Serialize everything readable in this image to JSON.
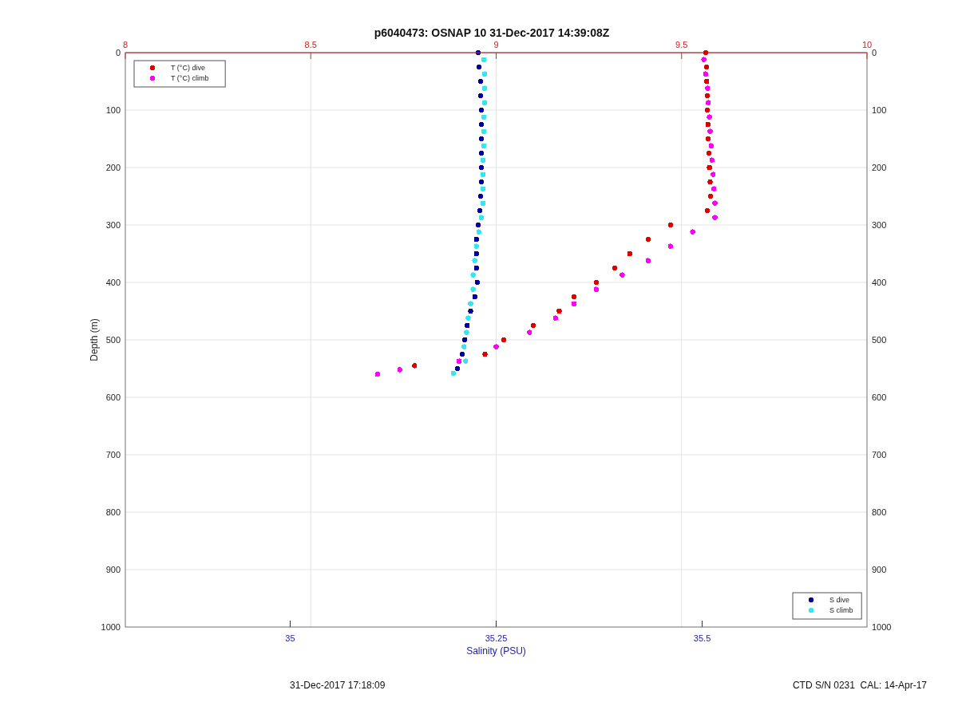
{
  "figure": {
    "title": "p6040473: OSNAP 10 31-Dec-2017 14:39:08Z",
    "salinity_axes": {
      "chart_data": {
        "type": "scatter",
        "xlabel": "Salinity (PSU)",
        "ylabel": "Depth (m)",
        "legend": "bottom-right",
        "xlim": [
          34.8,
          35.7
        ],
        "ylim": [
          1000,
          0
        ],
        "xticks": [
          35,
          35.25,
          35.5
        ],
        "yticks": [
          0,
          100,
          200,
          300,
          400,
          500,
          600,
          700,
          800,
          900,
          1000
        ],
        "series": [
          {
            "name": "S dive",
            "color": "#0000a0",
            "x": [
              35.228,
              35.229,
              35.231,
              35.231,
              35.232,
              35.232,
              35.232,
              35.232,
              35.232,
              35.232,
              35.231,
              35.23,
              35.228,
              35.226,
              35.226,
              35.226,
              35.227,
              35.224,
              35.219,
              35.215,
              35.212,
              35.209,
              35.203
            ],
            "values": [
              0,
              25,
              50,
              75,
              100,
              125,
              150,
              175,
              200,
              225,
              250,
              275,
              300,
              325,
              350,
              375,
              400,
              425,
              450,
              475,
              500,
              525,
              550
            ]
          },
          {
            "name": "S climb",
            "color": "#33e6f0",
            "x": [
              35.235,
              35.236,
              35.236,
              35.236,
              35.235,
              35.235,
              35.235,
              35.234,
              35.234,
              35.234,
              35.234,
              35.232,
              35.229,
              35.226,
              35.224,
              35.222,
              35.222,
              35.219,
              35.216,
              35.214,
              35.211,
              35.213,
              35.198
            ],
            "values": [
              12,
              37,
              62,
              87,
              112,
              137,
              162,
              187,
              212,
              237,
              262,
              287,
              312,
              337,
              362,
              387,
              412,
              437,
              462,
              487,
              512,
              537,
              558
            ]
          }
        ]
      }
    },
    "temperature_axes": {
      "chart_data": {
        "type": "scatter",
        "legend": "top-left",
        "xlim": [
          8,
          10
        ],
        "ylim": [
          1000,
          0
        ],
        "xticks": [
          8,
          8.5,
          9,
          9.5,
          10
        ],
        "yticks": [
          0,
          100,
          200,
          300,
          400,
          500,
          600,
          700,
          800,
          900,
          1000
        ],
        "series": [
          {
            "name": "T (°C) dive",
            "color": "#e00000",
            "x": [
              9.565,
              9.567,
              9.568,
              9.569,
              9.57,
              9.571,
              9.572,
              9.574,
              9.575,
              9.577,
              9.578,
              9.57,
              9.47,
              9.41,
              9.36,
              9.32,
              9.27,
              9.21,
              9.17,
              9.1,
              9.02,
              8.97,
              8.78
            ],
            "values": [
              0,
              25,
              50,
              75,
              100,
              125,
              150,
              175,
              200,
              225,
              250,
              275,
              300,
              325,
              350,
              375,
              400,
              425,
              450,
              475,
              500,
              525,
              545
            ]
          },
          {
            "name": "T (°C) climb",
            "color": "#ff00ff",
            "x": [
              9.56,
              9.565,
              9.57,
              9.572,
              9.575,
              9.577,
              9.58,
              9.582,
              9.585,
              9.587,
              9.59,
              9.59,
              9.53,
              9.47,
              9.41,
              9.34,
              9.27,
              9.21,
              9.16,
              9.09,
              9.0,
              8.9,
              8.74,
              8.68
            ],
            "values": [
              12,
              37,
              62,
              87,
              112,
              137,
              162,
              187,
              212,
              237,
              262,
              287,
              312,
              337,
              362,
              387,
              412,
              437,
              462,
              487,
              512,
              537,
              552,
              560
            ]
          }
        ]
      }
    },
    "footer_left": "31-Dec-2017 17:18:09",
    "footer_right": "CTD S/N 0231  CAL: 14-Apr-17"
  }
}
